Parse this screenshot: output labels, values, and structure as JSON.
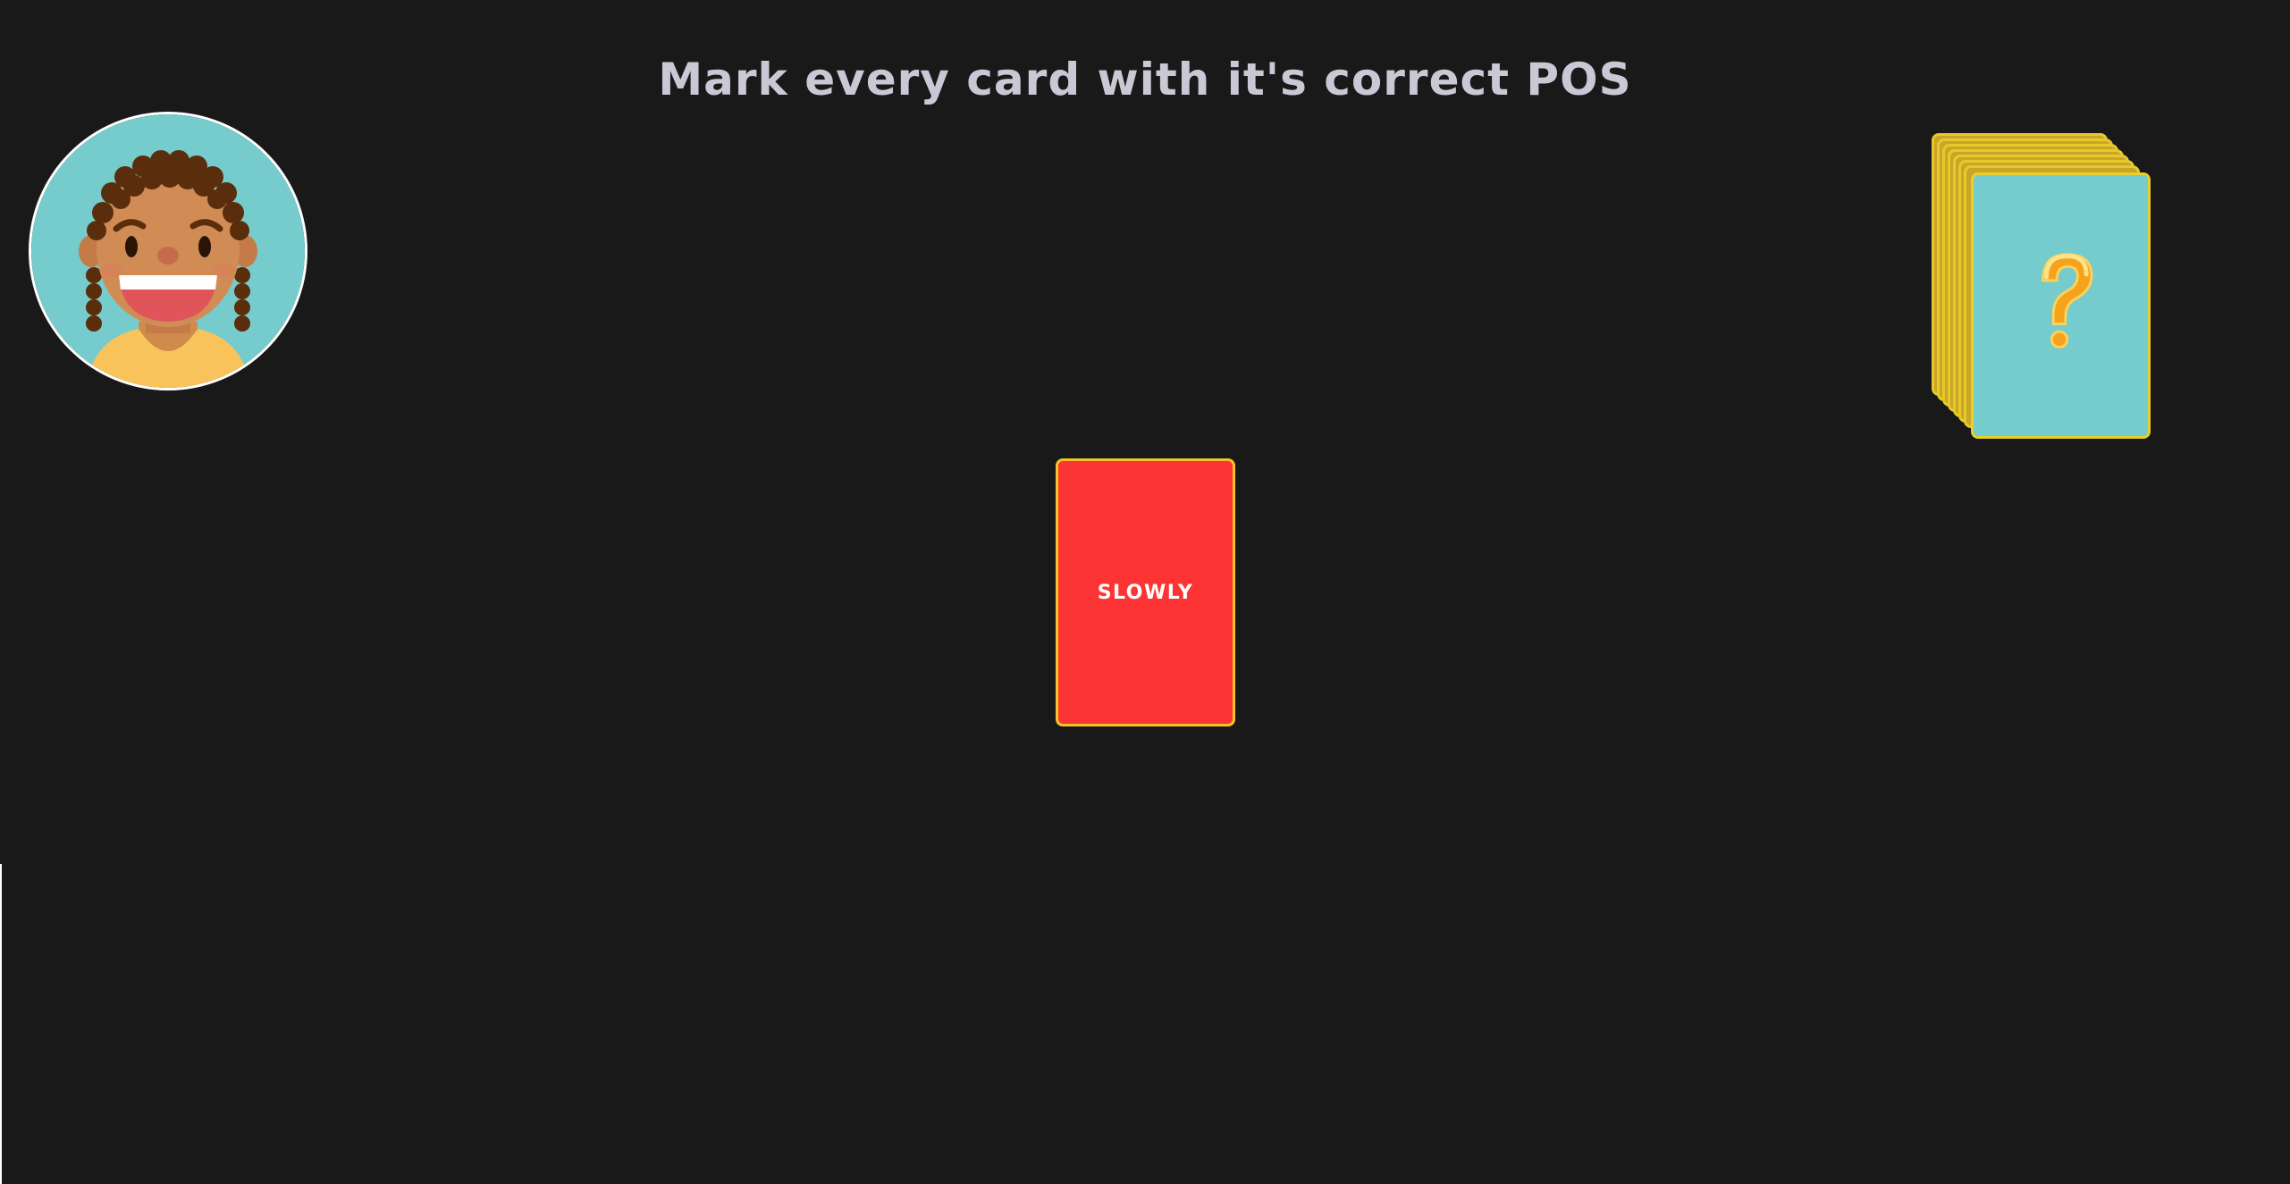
{
  "header": {
    "instruction": "Mark every card with it's correct POS"
  },
  "avatar": {
    "icon": "smiling-girl-avatar",
    "background_color": "#76cbcd"
  },
  "deck": {
    "icon": "question-mark-icon",
    "card_face_color": "#76cbcd",
    "card_border_color": "#e8d02a"
  },
  "current_card": {
    "word": "SLOWLY",
    "color": "#fc3434",
    "border_color": "#f3c427"
  }
}
